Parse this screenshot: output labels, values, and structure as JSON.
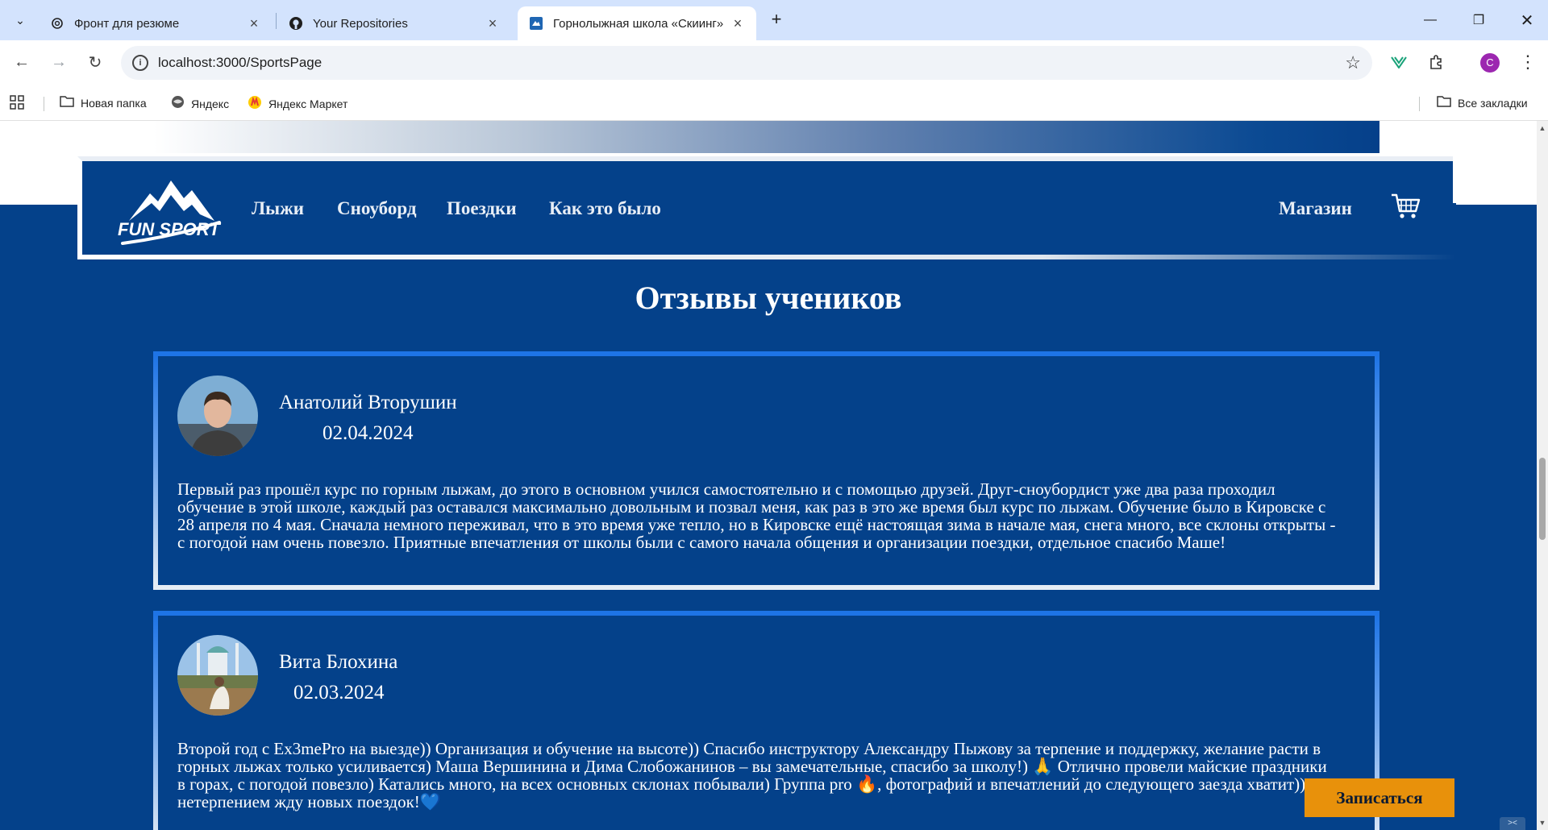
{
  "browser": {
    "tabs": [
      {
        "title": "Фронт для резюме",
        "icon": "openai-icon"
      },
      {
        "title": "Your Repositories",
        "icon": "github-icon"
      },
      {
        "title": "Горнолыжная школа «Скиинг»",
        "icon": "site-favicon-icon",
        "active": true
      }
    ],
    "url": "localhost:3000/SportsPage",
    "profile_initial": "C",
    "bookmarks": [
      {
        "label": "Новая папка",
        "icon": "folder-icon"
      },
      {
        "label": "Яндекс",
        "icon": "yandex-globe-icon"
      },
      {
        "label": "Яндекс Маркет",
        "icon": "yandex-market-icon"
      }
    ],
    "all_bookmarks": "Все закладки"
  },
  "site": {
    "logo_text": "FUN SPORT",
    "nav": [
      "Лыжи",
      "Сноуборд",
      "Поездки",
      "Как это было"
    ],
    "shop": "Магазин",
    "section_title": "Отзывы учеников",
    "signup_button": "Записаться",
    "colors": {
      "background": "#04418a",
      "accent": "#e8910b",
      "border": "#1e74e6"
    }
  },
  "reviews": [
    {
      "name": "Анатолий Вторушин",
      "date": "02.04.2024",
      "text": "Первый раз прошёл курс по горным лыжам, до этого в основном учился самостоятельно и с помощью друзей. Друг-сноубордист уже два раза проходил обучение в этой школе, каждый раз оставался максимально довольным и позвал меня, как раз в это же время был курс по лыжам. Обучение было в Кировске с 28 апреля по 4 мая. Сначала немного переживал, что в это время уже тепло, но в Кировске ещё настоящая зима в начале мая, снега много, все склоны открыты - с погодой нам очень повезло. Приятные впечатления от школы были с самого начала общения и организации поездки, отдельное спасибо Маше!"
    },
    {
      "name": "Вита Блохина",
      "date": "02.03.2024",
      "text": "Второй год с Ex3mePro на выезде)) Организация и обучение на высоте)) Спасибо инструктору Александру Пыжову за терпение и поддержку, желание расти в горных лыжах только усиливается) Маша Вершинина и Дима Слобожанинов – вы замечательные, спасибо за школу!) 🙏 Отлично провели майские праздники в горах, с погодой повезло) Катались много, на всех основных склонах побывали) Группа pro 🔥, фотографий и впечатлений до следующего заезда хватит)) С нетерпением жду новых поездок!💙"
    }
  ]
}
